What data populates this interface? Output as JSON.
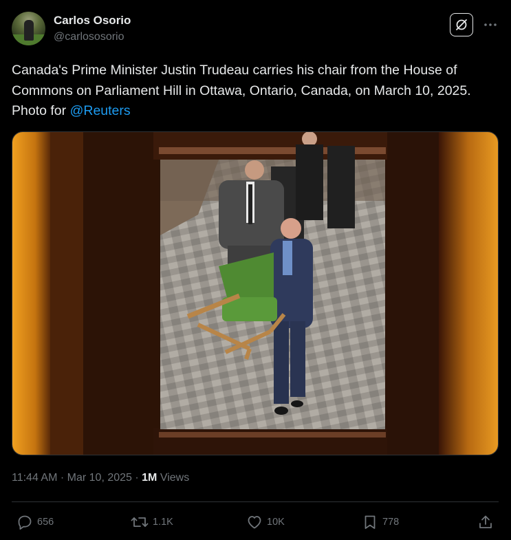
{
  "author": {
    "display_name": "Carlos Osorio",
    "handle": "@carlososorio"
  },
  "icons": {
    "grok": "grok-icon",
    "more": "more-options-icon",
    "reply": "reply-icon",
    "retweet": "retweet-icon",
    "like": "like-icon",
    "bookmark": "bookmark-icon",
    "share": "share-icon"
  },
  "tweet": {
    "text": "Canada's Prime Minister Justin Trudeau carries his chair from the House of Commons on Parliament Hill in Ottawa, Ontario, Canada, on March 10, 2025. Photo for ",
    "mention": "@Reuters"
  },
  "meta": {
    "time": "11:44 AM",
    "separator": " · ",
    "date": "Mar 10, 2025",
    "views_count": "1M",
    "views_label": " Views"
  },
  "actions": {
    "replies": "656",
    "retweets": "1.1K",
    "likes": "10K",
    "bookmarks": "778"
  },
  "colors": {
    "background": "#000000",
    "text": "#e7e9ea",
    "secondary": "#71767b",
    "link": "#1d9bf0",
    "border": "#2f3336"
  }
}
